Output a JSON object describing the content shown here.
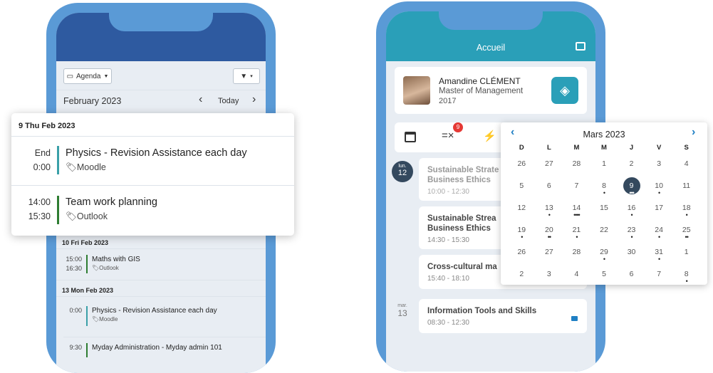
{
  "left": {
    "agenda_label": "Agenda",
    "month_label": "February 2023",
    "today_label": "Today",
    "popup": {
      "header": "9 Thu Feb 2023",
      "events": [
        {
          "start": "End",
          "end": "0:00",
          "title": "Physics - Revision Assistance each day",
          "source": "Moodle",
          "color": "#3aa0a8"
        },
        {
          "start": "14:00",
          "end": "15:30",
          "title": "Team work planning",
          "source": "Outlook",
          "color": "#2e7d32"
        }
      ]
    },
    "days": [
      {
        "header": "10 Fri Feb 2023",
        "events": [
          {
            "start": "15:00",
            "end": "16:30",
            "title": "Maths with GIS",
            "source": "Outlook",
            "color": "#2e7d32"
          }
        ]
      },
      {
        "header": "13 Mon Feb 2023",
        "events": [
          {
            "start": "0:00",
            "end": "",
            "title": "Physics - Revision Assistance each day",
            "source": "Moodle",
            "color": "#3aa0a8"
          },
          {
            "start": "9:30",
            "end": "",
            "title": "Myday Administration - Myday admin 101",
            "source": "",
            "color": "#2e7d32"
          }
        ]
      }
    ]
  },
  "right": {
    "header_title": "Accueil",
    "profile": {
      "name": "Amandine CLÉMENT",
      "program": "Master of Management",
      "year": "2017"
    },
    "tabs_badge": "9",
    "day1": {
      "weekday": "lun.",
      "day": "12"
    },
    "day2": {
      "weekday": "mar.",
      "day": "13"
    },
    "events": [
      {
        "title": "Sustainable Strate",
        "subtitle": "Business Ethics",
        "time": "10:00 - 12:30"
      },
      {
        "title": "Sustainable Strea",
        "subtitle": "Business Ethics",
        "time": "14:30 - 15:30"
      },
      {
        "title": "Cross-cultural ma",
        "subtitle": "",
        "time": "15:40 - 18:10"
      },
      {
        "title": "Information Tools and Skills",
        "subtitle": "",
        "time": "08:30 - 12:30"
      }
    ],
    "calendar": {
      "month": "Mars 2023",
      "weekdays": [
        "D",
        "L",
        "M",
        "M",
        "J",
        "V",
        "S"
      ],
      "weeks": [
        [
          {
            "d": "26",
            "dots": ""
          },
          {
            "d": "27",
            "dots": ""
          },
          {
            "d": "28",
            "dots": ""
          },
          {
            "d": "1",
            "dots": ""
          },
          {
            "d": "2",
            "dots": ""
          },
          {
            "d": "3",
            "dots": ""
          },
          {
            "d": "4",
            "dots": ""
          }
        ],
        [
          {
            "d": "5",
            "dots": ""
          },
          {
            "d": "6",
            "dots": ""
          },
          {
            "d": "7",
            "dots": ""
          },
          {
            "d": "8",
            "dots": "•"
          },
          {
            "d": "9",
            "dots": "•••",
            "selected": true
          },
          {
            "d": "10",
            "dots": "•"
          },
          {
            "d": "11",
            "dots": ""
          }
        ],
        [
          {
            "d": "12",
            "dots": ""
          },
          {
            "d": "13",
            "dots": "•"
          },
          {
            "d": "14",
            "dots": "••••"
          },
          {
            "d": "15",
            "dots": ""
          },
          {
            "d": "16",
            "dots": "•"
          },
          {
            "d": "17",
            "dots": ""
          },
          {
            "d": "18",
            "dots": "•"
          }
        ],
        [
          {
            "d": "19",
            "dots": "•"
          },
          {
            "d": "20",
            "dots": "••"
          },
          {
            "d": "21",
            "dots": "•"
          },
          {
            "d": "22",
            "dots": ""
          },
          {
            "d": "23",
            "dots": "•"
          },
          {
            "d": "24",
            "dots": "•"
          },
          {
            "d": "25",
            "dots": "••"
          }
        ],
        [
          {
            "d": "26",
            "dots": ""
          },
          {
            "d": "27",
            "dots": ""
          },
          {
            "d": "28",
            "dots": ""
          },
          {
            "d": "29",
            "dots": "•"
          },
          {
            "d": "30",
            "dots": ""
          },
          {
            "d": "31",
            "dots": "•"
          },
          {
            "d": "1",
            "dots": ""
          }
        ],
        [
          {
            "d": "2",
            "dots": ""
          },
          {
            "d": "3",
            "dots": ""
          },
          {
            "d": "4",
            "dots": ""
          },
          {
            "d": "5",
            "dots": ""
          },
          {
            "d": "6",
            "dots": ""
          },
          {
            "d": "7",
            "dots": ""
          },
          {
            "d": "8",
            "dots": "•"
          }
        ]
      ]
    }
  },
  "colors": {
    "phone_frame": "#5a9ad6",
    "header_navy": "#2e5aa0",
    "header_teal": "#2a9fb8",
    "selected_day": "#34495e",
    "nav_arrow": "#1f7fc4"
  }
}
